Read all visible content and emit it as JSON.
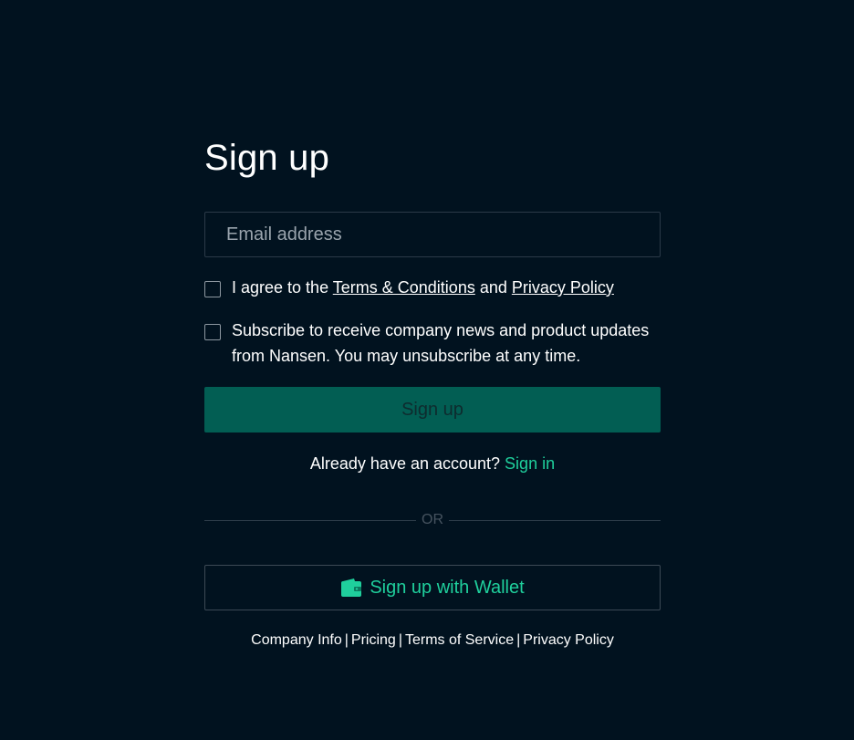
{
  "form": {
    "title": "Sign up",
    "email": {
      "placeholder": "Email address",
      "value": ""
    },
    "terms": {
      "prefix": "I agree to the ",
      "terms_link": "Terms & Conditions",
      "middle": " and ",
      "privacy_link": "Privacy Policy",
      "checked": false
    },
    "subscribe": {
      "text": "Subscribe to receive company news and product updates from Nansen. You may unsubscribe at any time.",
      "checked": false
    },
    "signup_button": "Sign up",
    "signin": {
      "prompt": "Already have an account? ",
      "link": "Sign in"
    },
    "divider_text": "OR",
    "wallet_button": "Sign up with Wallet"
  },
  "footer": {
    "links": [
      "Company Info",
      "Pricing",
      "Terms of Service",
      "Privacy Policy"
    ],
    "separator": "|"
  },
  "colors": {
    "background": "#01121f",
    "accent": "#1fcf9c",
    "primary_button": "#025e53"
  },
  "icons": {
    "wallet": "wallet-icon"
  }
}
